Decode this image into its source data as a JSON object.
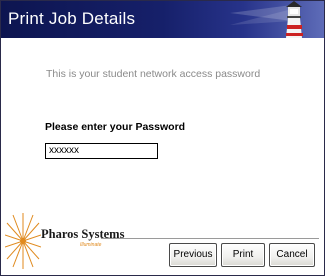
{
  "header": {
    "title": "Print Job Details",
    "logo_icon": "lighthouse-icon"
  },
  "body": {
    "subtitle": "This is your student network access password",
    "prompt": "Please enter your Password",
    "password_value": "xxxxxx"
  },
  "footer": {
    "brand": "Pharos Systems",
    "brand_tagline": "Illuminate",
    "brand_icon": "sunburst-icon",
    "buttons": {
      "previous": "Previous",
      "print": "Print",
      "cancel": "Cancel"
    }
  },
  "colors": {
    "header_dark": "#0d1550",
    "header_light": "#5e6cb8",
    "brand_accent": "#e08a1e"
  }
}
